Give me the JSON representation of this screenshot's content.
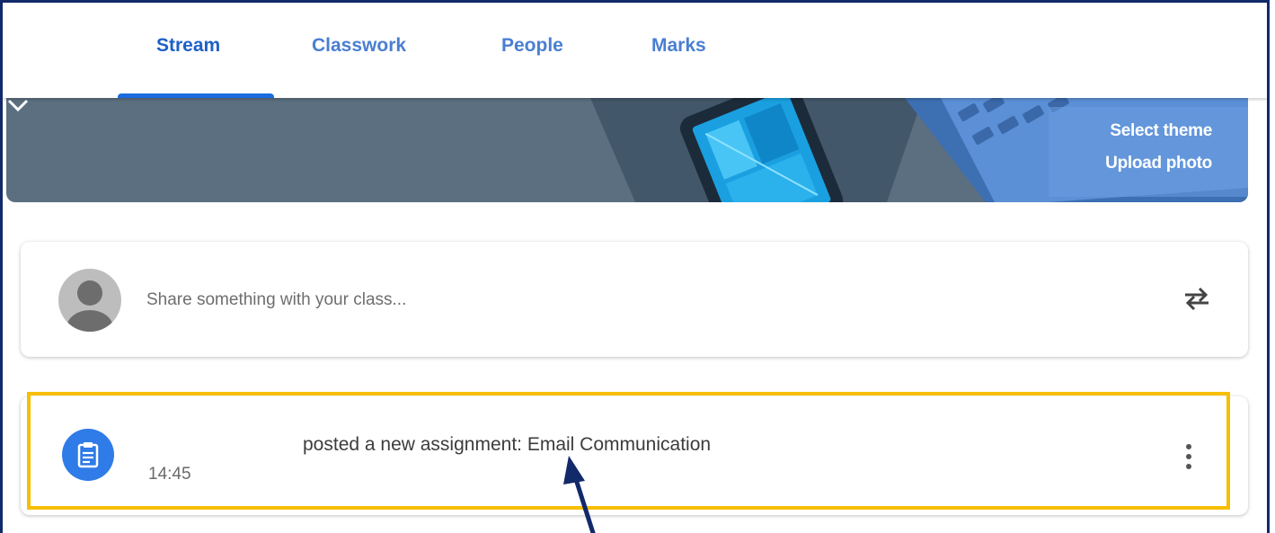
{
  "tabs": [
    {
      "label": "Stream",
      "active": true
    },
    {
      "label": "Classwork",
      "active": false
    },
    {
      "label": "People",
      "active": false
    },
    {
      "label": "Marks",
      "active": false
    }
  ],
  "banner": {
    "select_theme": "Select theme",
    "upload_photo": "Upload photo",
    "expand_icon": "chevron-down-icon"
  },
  "share": {
    "placeholder": "Share something with your class...",
    "repost_icon": "repost-icon"
  },
  "post": {
    "title": "posted a new assignment: Email Communication",
    "time": "14:45",
    "icon": "assignment-icon",
    "menu_icon": "more-vert-icon"
  },
  "colors": {
    "accent": "#1a6ce0",
    "banner": "#5b6f80",
    "highlight": "#f8be00",
    "assignment_icon_bg": "#2f7be7",
    "arrow": "#12296a"
  }
}
